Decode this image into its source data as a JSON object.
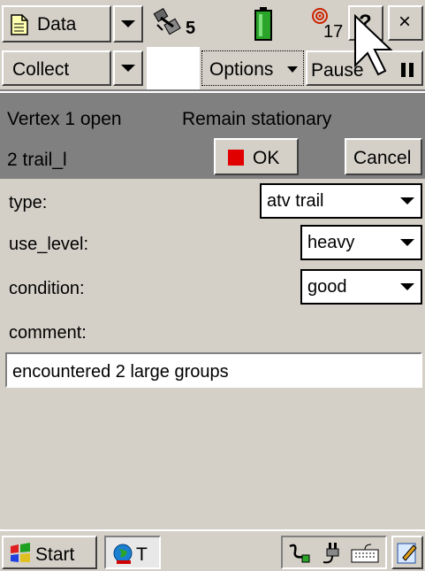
{
  "colors": {
    "chrome": "#d4d0c8",
    "panel": "#808080",
    "ok_square": "#e00000",
    "battery": "#2aa52a",
    "gps": "#cc2200"
  },
  "top": {
    "data_label": "Data",
    "sat_count": "5",
    "gps_count": "17",
    "help_icon": "question-mark",
    "close_glyph": "×"
  },
  "toolbar": {
    "collect_label": "Collect",
    "options_label": "Options",
    "pause_label": "Pause"
  },
  "status": {
    "vertex": "Vertex 1 open",
    "remain": "Remain stationary",
    "feature": "2 trail_l",
    "ok_label": "OK",
    "cancel_label": "Cancel"
  },
  "form": {
    "type": {
      "label": "type:",
      "value": "atv trail"
    },
    "use_level": {
      "label": "use_level:",
      "value": "heavy"
    },
    "condition": {
      "label": "condition:",
      "value": "good"
    },
    "comment": {
      "label": "comment:",
      "value": "encountered 2 large groups"
    }
  },
  "taskbar": {
    "start_label": "Start",
    "task_label": "T"
  }
}
